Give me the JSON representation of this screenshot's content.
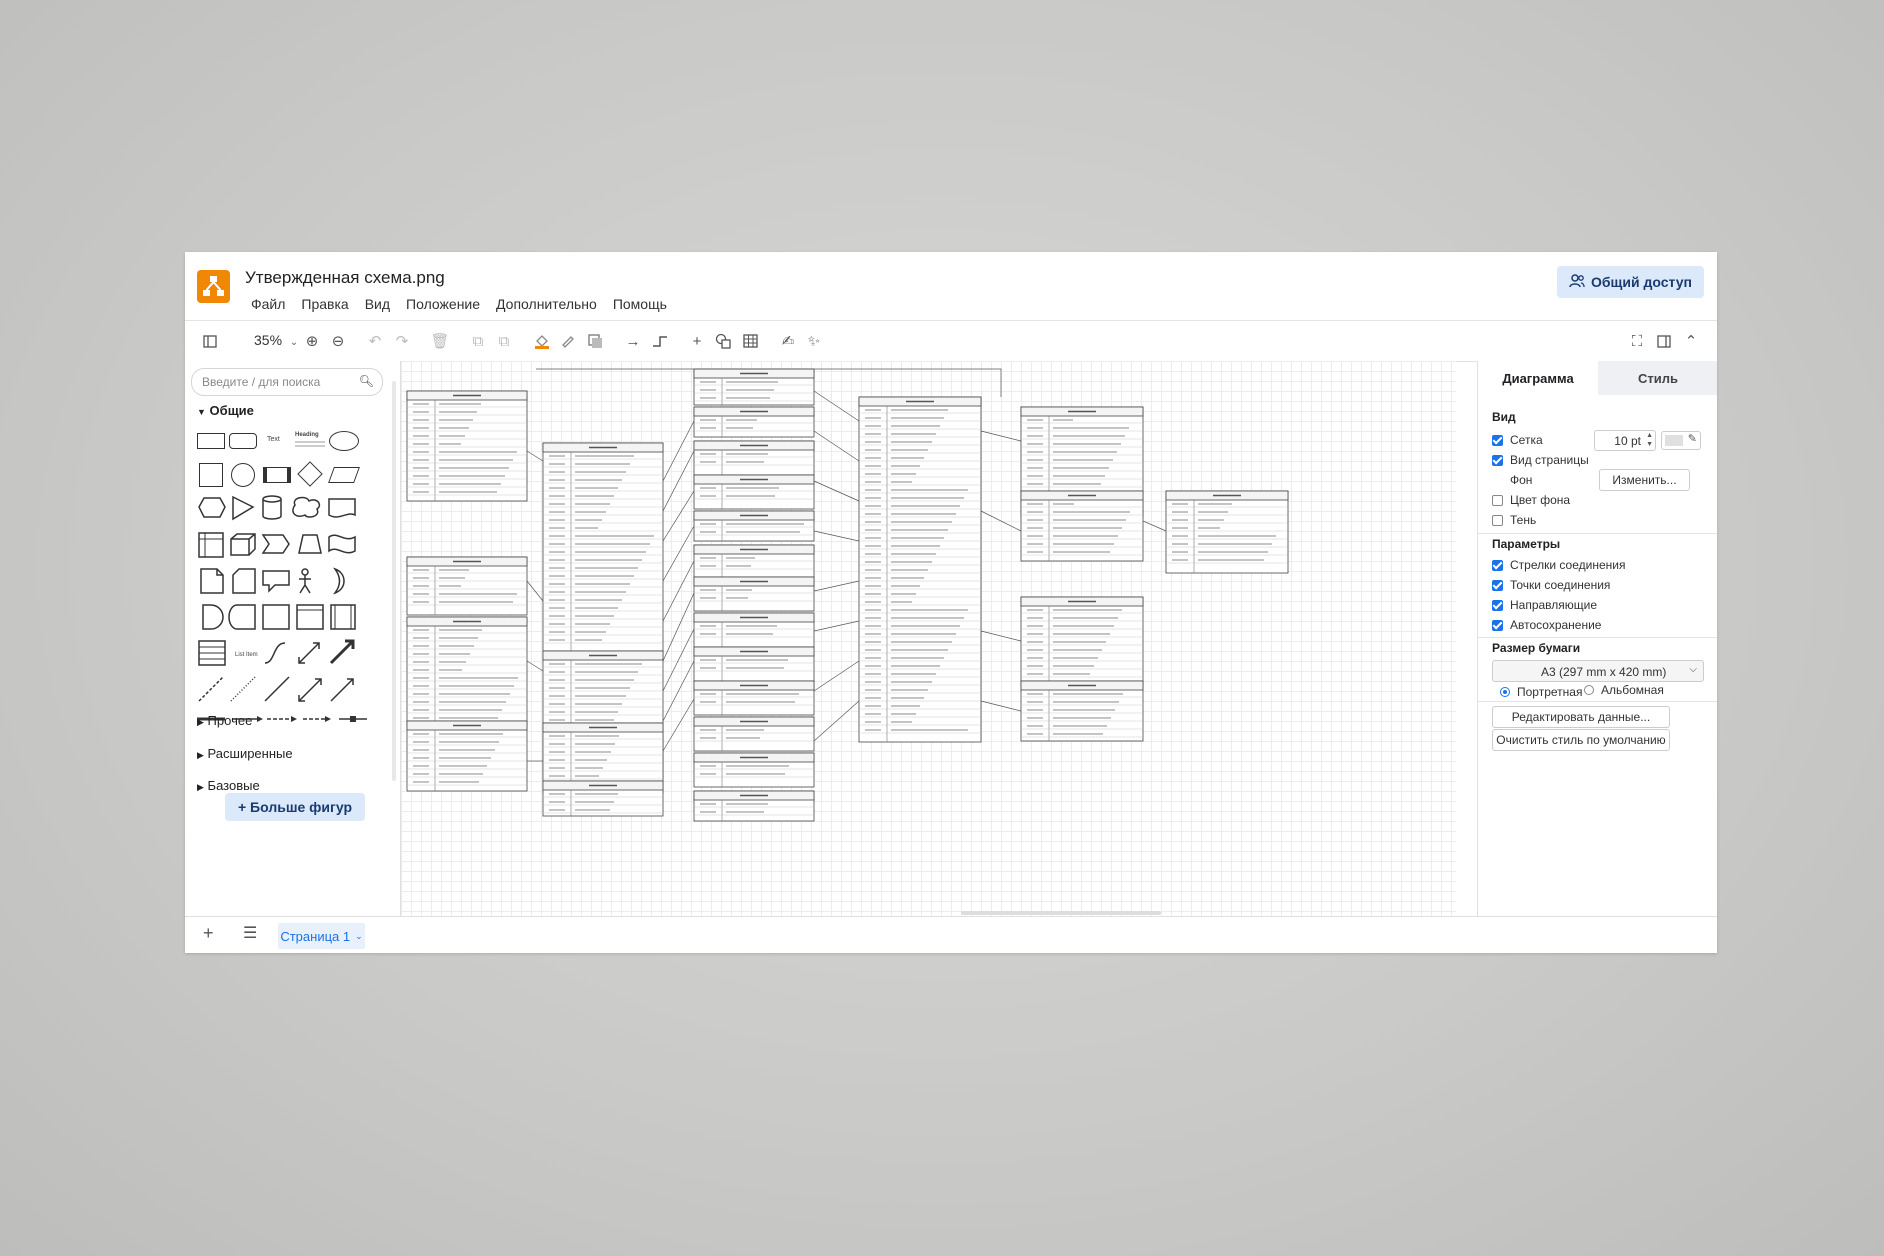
{
  "app": {
    "title": "Утвержденная схема.png",
    "menu": [
      "Файл",
      "Правка",
      "Вид",
      "Положение",
      "Дополнительно",
      "Помощь"
    ],
    "share_label": "Общий доступ",
    "brand_color": "#f08705",
    "accent_color": "#1a73e8"
  },
  "toolbar": {
    "zoom": "35%",
    "icons": [
      "sidebar-toggle-icon",
      "zoom-in-icon",
      "zoom-out-icon",
      "undo-icon",
      "redo-icon",
      "delete-icon",
      "to-front-icon",
      "to-back-icon",
      "fill-color-icon",
      "line-color-icon",
      "shadow-icon",
      "connection-icon",
      "waypoints-icon",
      "insert-icon",
      "shapes-icon",
      "table-icon",
      "freehand-icon",
      "magic-icon",
      "fullscreen-icon",
      "format-panel-icon",
      "collapse-icon"
    ]
  },
  "left": {
    "search_placeholder": "Введите / для поиска",
    "section_general": "Общие",
    "shape_text": "Text",
    "shape_heading": "Heading",
    "shape_list": "List Item",
    "sections": [
      "Прочее",
      "Расширенные",
      "Базовые"
    ],
    "more_shapes": "+ Больше фигур"
  },
  "right": {
    "tab_diagram": "Диаграмма",
    "tab_style": "Стиль",
    "view_heading": "Вид",
    "grid_label": "Сетка",
    "grid_size": "10 pt",
    "page_view_label": "Вид страницы",
    "background_label": "Фон",
    "change_button": "Изменить...",
    "bg_color_label": "Цвет фона",
    "shadow_label": "Тень",
    "params_heading": "Параметры",
    "arrows_label": "Стрелки соединения",
    "points_label": "Точки соединения",
    "guides_label": "Направляющие",
    "autosave_label": "Автосохранение",
    "paper_heading": "Размер бумаги",
    "paper_size": "A3 (297 mm x 420 mm)",
    "portrait_label": "Портретная",
    "landscape_label": "Альбомная",
    "edit_data_button": "Редактировать данные...",
    "clear_style_button": "Очистить стиль по умолчанию"
  },
  "bottom": {
    "page_label": "Страница 1"
  }
}
